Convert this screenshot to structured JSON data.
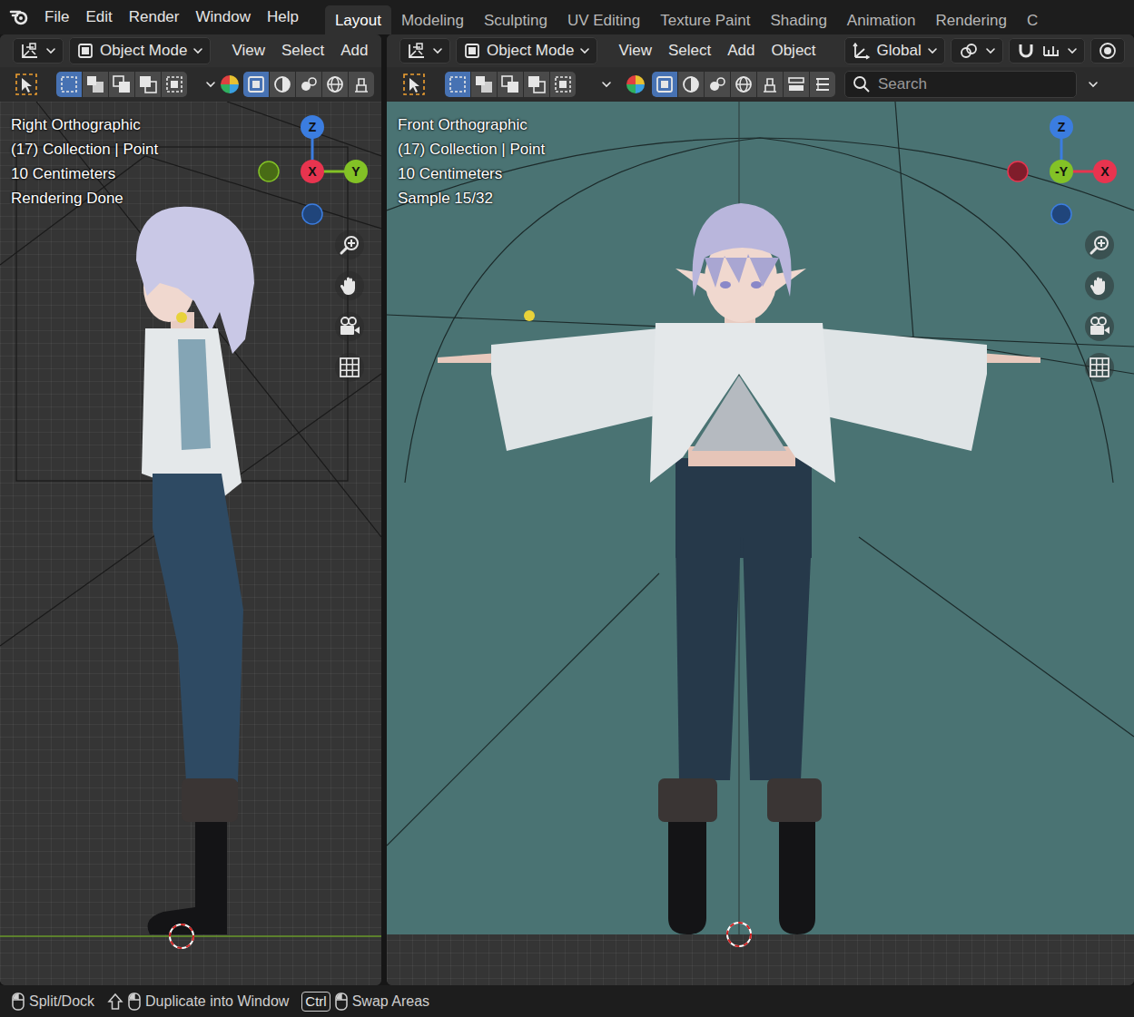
{
  "app_menu": [
    "File",
    "Edit",
    "Render",
    "Window",
    "Help"
  ],
  "workspaces": [
    {
      "label": "Layout",
      "selected": true
    },
    {
      "label": "Modeling",
      "selected": false
    },
    {
      "label": "Sculpting",
      "selected": false
    },
    {
      "label": "UV Editing",
      "selected": false
    },
    {
      "label": "Texture Paint",
      "selected": false
    },
    {
      "label": "Shading",
      "selected": false
    },
    {
      "label": "Animation",
      "selected": false
    },
    {
      "label": "Rendering",
      "selected": false
    },
    {
      "label": "C",
      "selected": false
    }
  ],
  "viewports": [
    {
      "kind": "side",
      "mode": "Object Mode",
      "menus": [
        "View",
        "Select",
        "Add"
      ],
      "select_modes": [
        {
          "selected": true
        },
        {
          "selected": false
        },
        {
          "selected": false
        },
        {
          "selected": false
        },
        {
          "selected": false
        }
      ],
      "view_toggles": [
        {
          "selected": true
        },
        {
          "selected": false
        },
        {
          "selected": false
        },
        {
          "selected": false
        },
        {
          "selected": false
        }
      ],
      "overlay": [
        "Right Orthographic",
        "(17) Collection | Point",
        "10 Centimeters",
        "Rendering Done"
      ],
      "gizmo": [
        {
          "label": "Z",
          "color": "#3b7de0"
        },
        {
          "label": "X",
          "color": "#e8344f"
        },
        {
          "label": "Y",
          "color": "#83c226"
        }
      ]
    },
    {
      "kind": "front",
      "mode": "Object Mode",
      "menus": [
        "View",
        "Select",
        "Add",
        "Object"
      ],
      "transform": "Global",
      "search": {
        "placeholder": "Search"
      },
      "select_modes": [
        {
          "selected": true
        },
        {
          "selected": false
        },
        {
          "selected": false
        },
        {
          "selected": false
        },
        {
          "selected": false
        }
      ],
      "view_toggles": [
        {
          "selected": true
        },
        {
          "selected": false
        },
        {
          "selected": false
        },
        {
          "selected": false
        },
        {
          "selected": false
        },
        {
          "selected": false
        },
        {
          "selected": false
        }
      ],
      "overlay": [
        "Front Orthographic",
        "(17) Collection | Point",
        "10 Centimeters",
        "Sample 15/32"
      ],
      "gizmo": [
        {
          "label": "Z",
          "color": "#3b7de0"
        },
        {
          "label": "-Y",
          "color": "#83c226"
        },
        {
          "label": "X",
          "color": "#e8344f"
        }
      ]
    }
  ],
  "status_bar": [
    {
      "kind": "mouse",
      "label": "Split/Dock"
    },
    {
      "kind": "shift",
      "label": "Duplicate into Window"
    },
    {
      "kind": "ctrl",
      "key": "Ctrl",
      "label": "Swap Areas"
    }
  ]
}
